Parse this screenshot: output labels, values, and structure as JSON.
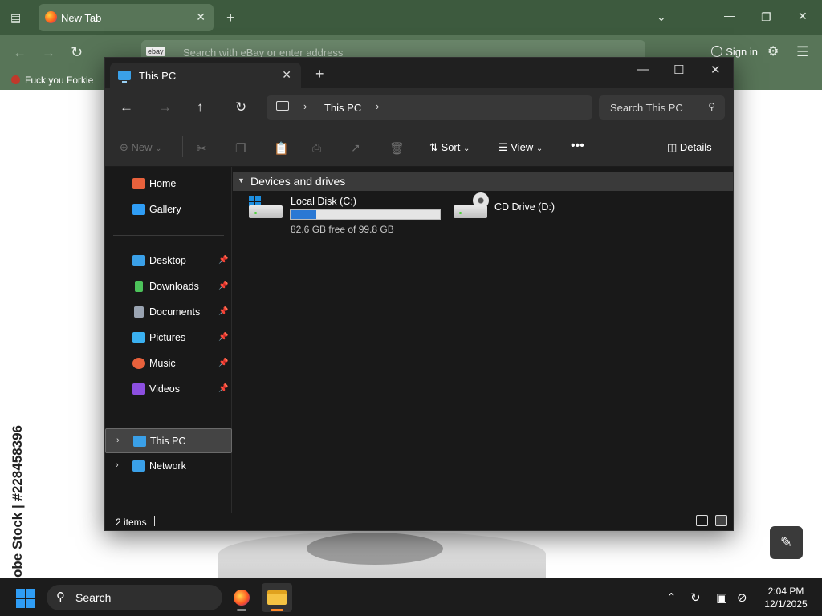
{
  "browser": {
    "tab_title": "New Tab",
    "url_placeholder": "Search with eBay or enter address",
    "search_engine_badge": "ebay",
    "signin_label": "Sign in",
    "bookmark": "Fuck you Forkie"
  },
  "background": {
    "watermark_text": "obe Stock | #228458396"
  },
  "explorer": {
    "tab_title": "This PC",
    "breadcrumb": "This PC",
    "search_placeholder": "Search This PC",
    "commands": {
      "new": "New",
      "sort": "Sort",
      "view": "View",
      "details": "Details"
    },
    "sidebar": {
      "items": [
        {
          "label": "Home",
          "icon": "home-icon",
          "color": "#e8613c"
        },
        {
          "label": "Gallery",
          "icon": "gallery-icon",
          "color": "#2f9df5"
        },
        {
          "label": "Desktop",
          "icon": "desktop-icon",
          "color": "#3aa0e8"
        },
        {
          "label": "Downloads",
          "icon": "download-icon",
          "color": "#4cc25a"
        },
        {
          "label": "Documents",
          "icon": "document-icon",
          "color": "#9aa4b2"
        },
        {
          "label": "Pictures",
          "icon": "pictures-icon",
          "color": "#3ab0f0"
        },
        {
          "label": "Music",
          "icon": "music-icon",
          "color": "#e8613c"
        },
        {
          "label": "Videos",
          "icon": "video-icon",
          "color": "#8c4fe0"
        },
        {
          "label": "This PC",
          "icon": "this-pc-icon",
          "color": "#3aa0e8"
        },
        {
          "label": "Network",
          "icon": "network-icon",
          "color": "#3aa0e8"
        }
      ]
    },
    "group_header": "Devices and drives",
    "drives": [
      {
        "name": "Local Disk (C:)",
        "free_text": "82.6 GB free of 99.8 GB",
        "used_fraction": 0.172
      },
      {
        "name": "CD Drive (D:)"
      }
    ],
    "status": {
      "item_count": "2 items"
    }
  },
  "taskbar": {
    "search_label": "Search",
    "time": "2:04 PM",
    "date": "12/1/2025"
  }
}
